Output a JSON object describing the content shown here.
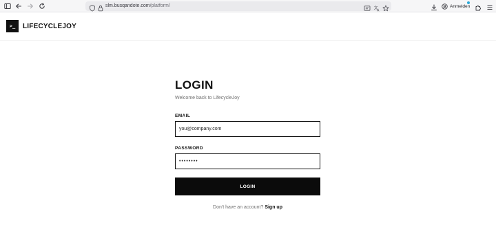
{
  "browser": {
    "url_host": "slm.busqandote.com",
    "url_path": "/platform/",
    "account_label": "Anmelden",
    "icons": [
      "sidebar-icon",
      "back-arrow-icon",
      "forward-arrow-icon",
      "reload-icon",
      "shield-icon",
      "lock-icon",
      "reader-view-icon",
      "translate-icon",
      "bookmark-star-icon",
      "download-icon",
      "account-icon",
      "extensions-icon",
      "menu-icon"
    ]
  },
  "brand": {
    "logo_glyph": ">_",
    "name": "LIFECYCLEJOY"
  },
  "login": {
    "title": "LOGIN",
    "subtitle": "Welcome back to LifecycleJoy",
    "email_label": "EMAIL",
    "email_placeholder": "you@company.com",
    "password_label": "PASSWORD",
    "password_placeholder": "••••••••",
    "submit_label": "LOGIN",
    "signup_prompt": "Don't have an account?",
    "signup_link": "Sign up"
  },
  "colors": {
    "primary": "#0b0b0b",
    "background": "#ffffff",
    "muted_text": "#6e6e6e",
    "chrome": "#f6f6f7",
    "account_dot": "#2aa8d8"
  }
}
